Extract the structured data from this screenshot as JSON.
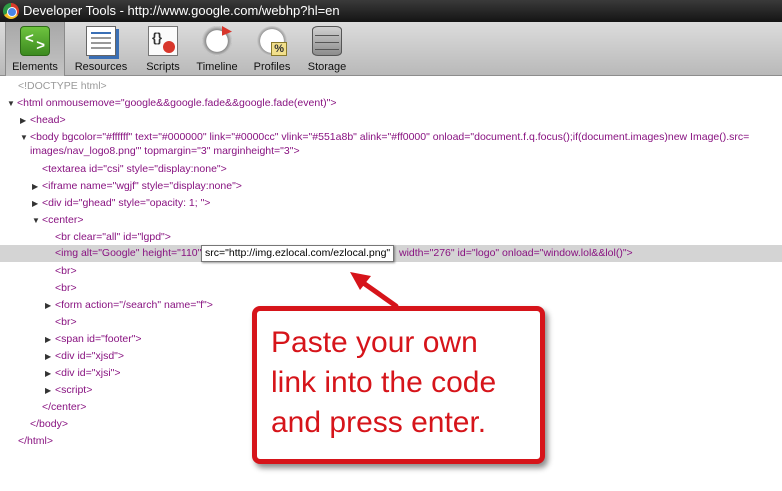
{
  "window": {
    "title": "Developer Tools - http://www.google.com/webhp?hl=en"
  },
  "toolbar": {
    "tools": [
      {
        "label": "Elements",
        "icon": "elements-icon",
        "selected": true
      },
      {
        "label": "Resources",
        "icon": "resources-icon"
      },
      {
        "label": "Scripts",
        "icon": "scripts-icon"
      },
      {
        "label": "Timeline",
        "icon": "timeline-icon"
      },
      {
        "label": "Profiles",
        "icon": "profiles-icon"
      },
      {
        "label": "Storage",
        "icon": "storage-icon"
      }
    ]
  },
  "code": {
    "doctype": "<!DOCTYPE html>",
    "html_open": "<html onmousemove=\"google&&google.fade&&google.fade(event)\">",
    "head": "<head>",
    "body_open_1": "<body bgcolor=\"#ffffff\" text=\"#000000\" link=\"#0000cc\" vlink=\"#551a8b\" alink=\"#ff0000\" onload=\"document.f.q.focus();if(document.images)new Image().src=",
    "body_open_2": "images/nav_logo8.png'\" topmargin=\"3\" marginheight=\"3\">",
    "textarea": "<textarea id=\"csi\" style=\"display:none\">",
    "iframe": "<iframe name=\"wgjf\" style=\"display:none\">",
    "div_ghead": "<div id=\"ghead\" style=\"opacity: 1; \">",
    "center_open": "<center>",
    "br_clear": "<br clear=\"all\" id=\"lgpd\">",
    "img_prefix": "<img alt=\"Google\" height=\"110\"",
    "img_suffix": "width=\"276\" id=\"logo\" onload=\"window.lol&&lol()\">",
    "img_edit_value": "src=\"http://img.ezlocal.com/ezlocal.png\"",
    "br": "<br>",
    "form": "<form action=\"/search\" name=\"f\">",
    "span_footer": "<span id=\"footer\">",
    "div_xjsd": "<div id=\"xjsd\">",
    "div_xjsi": "<div id=\"xjsi\">",
    "script": "<script>",
    "center_close": "</center>",
    "body_close": "</body>",
    "html_close": "</html>"
  },
  "callout": {
    "text": "Paste your own link into the code and press enter."
  }
}
